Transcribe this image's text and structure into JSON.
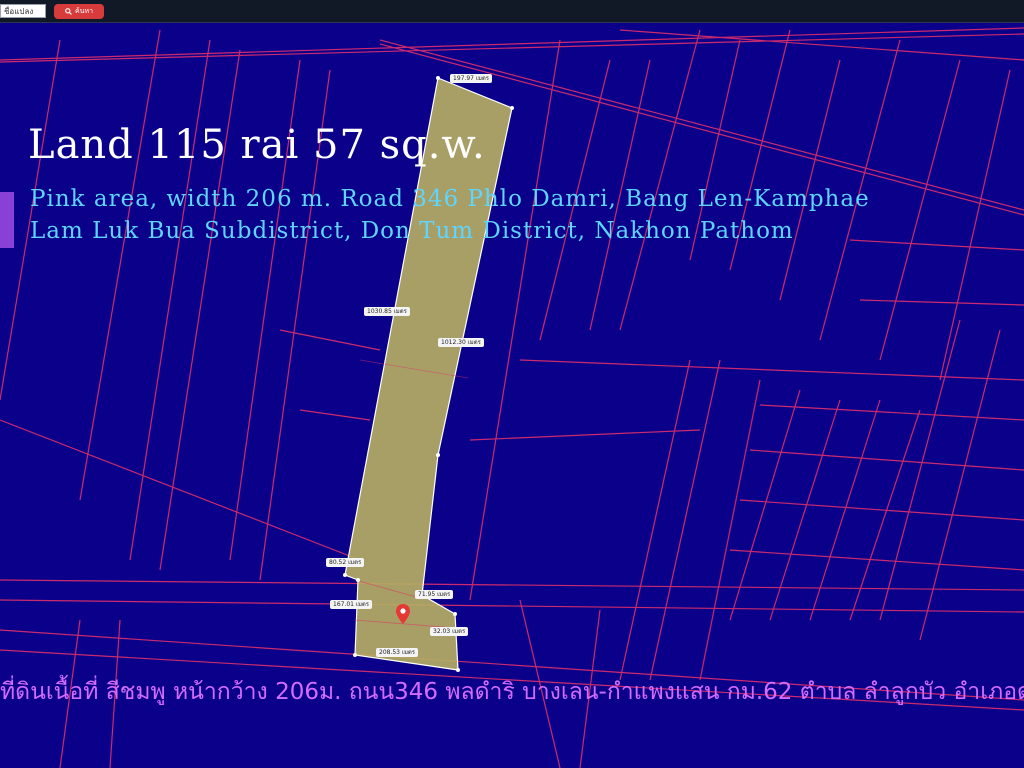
{
  "toolbar": {
    "search_value": "ชื่อแปลง",
    "search_button_label": "ค้นหา",
    "search_icon": "search-icon"
  },
  "map": {
    "colors": {
      "background": "#0a008a",
      "parcel_lines": "#e0306a",
      "highlighted_parcel": "#b8b060",
      "heading_text": "#ffffff",
      "subtitle_text": "#5fd5ff",
      "caption_text": "#d36cff",
      "accent_swatch": "#8a3fd6"
    },
    "title": "Land 115 rai 57 sq.w.",
    "subtitle_line1": "Pink area, width 206 m. Road 346 Phlo Damri, Bang Len-Kamphae",
    "subtitle_line2": "Lam Luk Bua Subdistrict, Don Tum District, Nakhon Pathom",
    "measurements": [
      "197.97 เมตร",
      "1030.85 เมตร",
      "1012.30 เมตร",
      "80.52 เมตร",
      "71.95 เมตร",
      "167.01 เมตร",
      "32.03 เมตร",
      "208.53 เมตร"
    ],
    "pin_icon": "location-pin-icon",
    "thai_caption": "ที่ดินเนื้อที่ สีชมพู หน้ากว้าง 206ม. ถนน346 พลดำริ บางเลน-กำแพงแสน กม.62 ตำบล ลำลูกบัว อำเภอดอนตูม นครปฐม"
  }
}
